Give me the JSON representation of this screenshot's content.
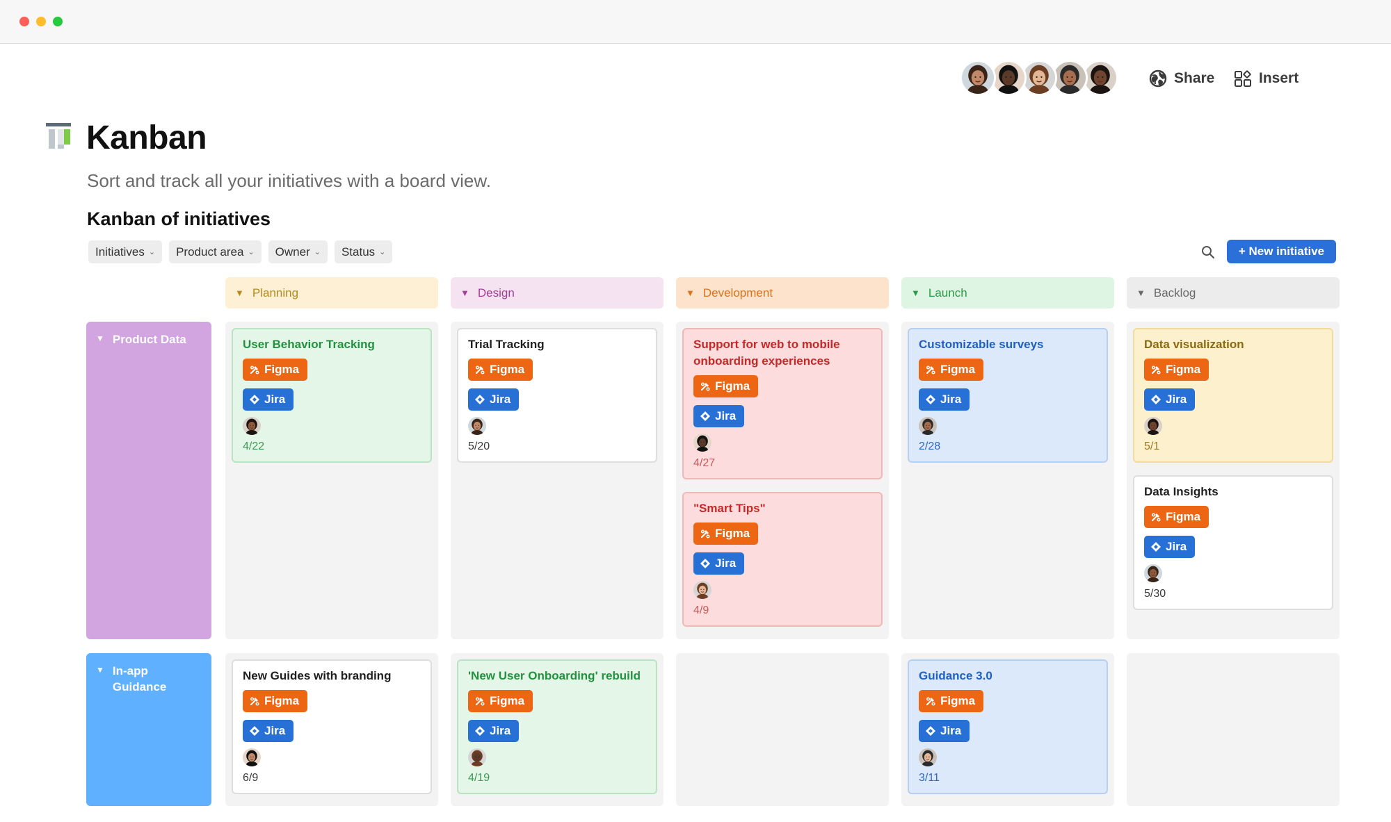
{
  "page": {
    "title": "Kanban",
    "subtitle": "Sort and track all your initiatives with a board view.",
    "section_title": "Kanban of initiatives"
  },
  "topbar": {
    "share_label": "Share",
    "insert_label": "Insert",
    "collaborator_count": 5
  },
  "filters": [
    {
      "label": "Initiatives"
    },
    {
      "label": "Product area"
    },
    {
      "label": "Owner"
    },
    {
      "label": "Status"
    }
  ],
  "new_button_label": "+ New initiative",
  "columns": [
    {
      "label": "Planning",
      "bg": "#fdf0d4",
      "fg": "#b58a1d"
    },
    {
      "label": "Design",
      "bg": "#f5e3f1",
      "fg": "#a43e98"
    },
    {
      "label": "Development",
      "bg": "#fde2cc",
      "fg": "#d9741c"
    },
    {
      "label": "Launch",
      "bg": "#dff5e3",
      "fg": "#2b9a47"
    },
    {
      "label": "Backlog",
      "bg": "#ececec",
      "fg": "#6a6a6a"
    }
  ],
  "rows": [
    {
      "label": "Product Data",
      "color": "#d2a4e0"
    },
    {
      "label": "In-app Guidance",
      "color": "#5fb0ff"
    }
  ],
  "cards": {
    "r0c0": [
      {
        "title": "User Behavior Tracking",
        "date": "4/22",
        "theme": "green"
      }
    ],
    "r0c1": [
      {
        "title": "Trial Tracking",
        "date": "5/20",
        "theme": "white"
      }
    ],
    "r0c2": [
      {
        "title": "Support for web to mobile onboarding experiences",
        "date": "4/27",
        "theme": "red"
      },
      {
        "title": "\"Smart Tips\"",
        "date": "4/9",
        "theme": "red"
      }
    ],
    "r0c3": [
      {
        "title": "Customizable surveys",
        "date": "2/28",
        "theme": "blue"
      }
    ],
    "r0c4": [
      {
        "title": "Data visualization",
        "date": "5/1",
        "theme": "yellow"
      },
      {
        "title": "Data Insights",
        "date": "5/30",
        "theme": "white"
      }
    ],
    "r1c0": [
      {
        "title": "New Guides with branding",
        "date": "6/9",
        "theme": "white"
      }
    ],
    "r1c1": [
      {
        "title": "'New User Onboarding' rebuild",
        "date": "4/19",
        "theme": "green"
      }
    ],
    "r1c2": [],
    "r1c3": [
      {
        "title": "Guidance 3.0",
        "date": "3/11",
        "theme": "blue"
      }
    ],
    "r1c4": []
  },
  "tags": {
    "figma": "Figma",
    "jira": "Jira"
  },
  "themes": {
    "green": {
      "bg": "#e3f6e7",
      "border": "#b9e3c2",
      "title": "#23923f",
      "date": "#3c9a52"
    },
    "white": {
      "bg": "#ffffff",
      "border": "#dedede",
      "title": "#1f1f1f",
      "date": "#3a3a3a"
    },
    "red": {
      "bg": "#fcdcdc",
      "border": "#f1b8b8",
      "title": "#c62828",
      "date": "#c75a5a"
    },
    "blue": {
      "bg": "#dce9fb",
      "border": "#b7cff2",
      "title": "#1f5fc4",
      "date": "#2e68c5"
    },
    "yellow": {
      "bg": "#fdf0cd",
      "border": "#f2dc9c",
      "title": "#8a6a10",
      "date": "#9a7a20"
    }
  }
}
